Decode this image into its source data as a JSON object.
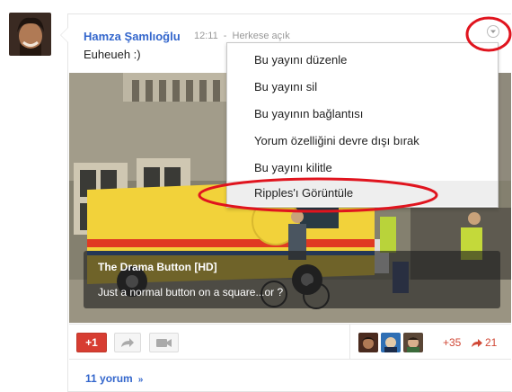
{
  "post": {
    "author": "Hamza Şamlıoğlu",
    "time": "12:11",
    "separator": "-",
    "visibility": "Herkese açık",
    "text": "Euheueh :)"
  },
  "video": {
    "title": "The Drama Button [HD]",
    "description": "Just a normal button on a square...or ?"
  },
  "actions": {
    "plus_one_label": "+1",
    "plus_count": "+35",
    "share_count": "21",
    "share_icon": "share-arrow-icon",
    "hangout_icon": "video-camera-icon"
  },
  "menu": {
    "items": [
      {
        "label": "Bu yayını düzenle"
      },
      {
        "label": "Bu yayını sil"
      },
      {
        "label": "Bu yayının bağlantısı"
      },
      {
        "label": "Yorum özelliğini devre dışı bırak"
      },
      {
        "label": "Bu yayını kilitle"
      },
      {
        "label": "Ripples'ı Görüntüle"
      }
    ],
    "highlighted_index": 5
  },
  "comments": {
    "label": "11 yorum",
    "expand_icon": "chevron-down-icon"
  },
  "colors": {
    "link_blue": "#3366cc",
    "plus_red": "#d73d32",
    "annotation_red": "#e0141e"
  }
}
